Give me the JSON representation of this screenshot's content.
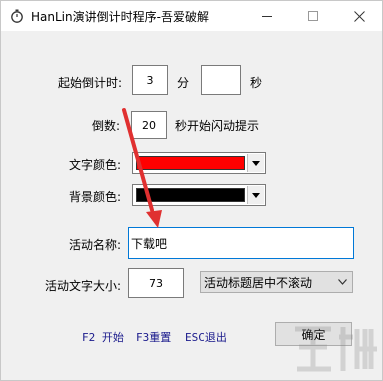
{
  "window": {
    "title": "HanLin演讲倒计时程序-吾爱破解"
  },
  "form": {
    "countdown_label": "起始倒计时:",
    "minutes_value": "3",
    "minutes_unit": "分",
    "seconds_value": "",
    "seconds_unit": "秒",
    "reverse_label": "倒数:",
    "reverse_value": "20",
    "reverse_suffix": "秒开始闪动提示",
    "text_color_label": "文字颜色:",
    "text_color": "#ff0000",
    "bg_color_label": "背景颜色:",
    "bg_color": "#000000",
    "event_name_label": "活动名称:",
    "event_name_value": "下载吧",
    "font_size_label": "活动文字大小:",
    "font_size_value": "73",
    "scroll_mode_selected": "活动标题居中不滚动"
  },
  "hotkeys": {
    "f2": "F2 开始",
    "f3": "F3重置",
    "esc": "ESC退出"
  },
  "buttons": {
    "ok": "确定"
  },
  "icons": {
    "app": "timer-icon",
    "minimize": "minimize-icon",
    "maximize": "maximize-icon",
    "close": "close-icon",
    "dropdown": "chevron-down-icon"
  },
  "colors": {
    "annotation_arrow": "#e03030",
    "focus_border": "#0078d7"
  }
}
